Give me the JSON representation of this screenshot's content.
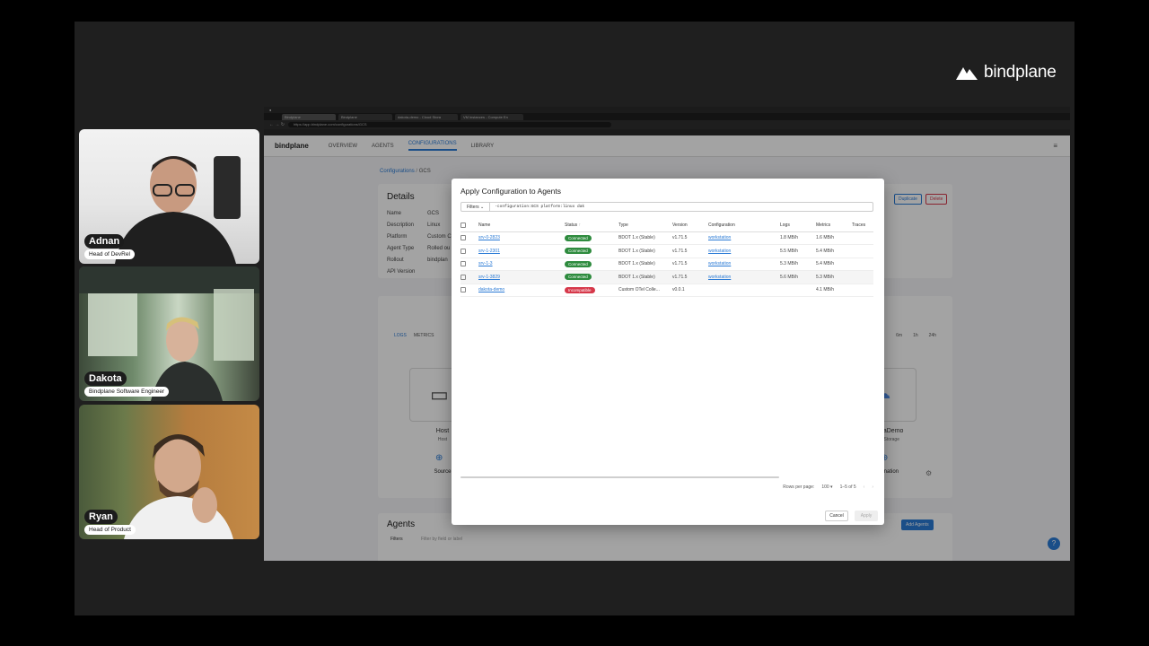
{
  "brand": {
    "name": "bindplane"
  },
  "participants": [
    {
      "name": "Adnan",
      "role": "Head of DevRel"
    },
    {
      "name": "Dakota",
      "role": "Bindplane Software Engineer"
    },
    {
      "name": "Ryan",
      "role": "Head of Product"
    }
  ],
  "browser": {
    "tabs": [
      "Bindplane",
      "Bindplane",
      "dakota-demo - Cloud Stora",
      "VM instances - Compute En"
    ],
    "url": "https://app.bindplane.com/configurations/GCS"
  },
  "app": {
    "logo": "bindplane",
    "nav": [
      "OVERVIEW",
      "AGENTS",
      "CONFIGURATIONS",
      "LIBRARY"
    ],
    "breadcrumb": [
      "Configurations",
      "GCS"
    ],
    "details": {
      "title": "Details",
      "labels": [
        "Name",
        "Description",
        "Platform",
        "Agent Type",
        "Rollout",
        "API Version"
      ],
      "values": [
        "GCS",
        "",
        "Linux",
        "Custom C",
        "Rolled ou",
        "bindplan"
      ]
    },
    "buttons": {
      "duplicate": "Duplicate",
      "delete": "Delete",
      "add_agents": "Add Agents"
    },
    "telemetry_tabs": [
      "LOGS",
      "METRICS"
    ],
    "ranges": [
      "6m",
      "1h",
      "24h"
    ],
    "source": {
      "name": "Host",
      "type": "Host",
      "label": "Source"
    },
    "destination": {
      "name": "DakotaDemo",
      "type": "Cloud Storage",
      "label": "Destination"
    },
    "agents_section": {
      "title": "Agents",
      "filters": "Filters",
      "placeholder": "Filter by field or label"
    }
  },
  "modal": {
    "title": "Apply Configuration to Agents",
    "filters_label": "Filters",
    "query": "-configuration:GCS platform:linux dak",
    "columns": [
      "Name",
      "Status",
      "Type",
      "Version",
      "Configuration",
      "Logs",
      "Metrics",
      "Traces"
    ],
    "rows": [
      {
        "name": "srv-0-2823",
        "status": "Connected",
        "type": "BDOT 1.x (Stable)",
        "version": "v1.71.5",
        "configuration": "workstation",
        "logs": "1.8 MB/h",
        "metrics": "1.6 MB/h"
      },
      {
        "name": "srv-1-2301",
        "status": "Connected",
        "type": "BDOT 1.x (Stable)",
        "version": "v1.71.5",
        "configuration": "workstation",
        "logs": "5.5 MB/h",
        "metrics": "5.4 MB/h"
      },
      {
        "name": "srv-1-3",
        "status": "Connected",
        "type": "BDOT 1.x (Stable)",
        "version": "v1.71.5",
        "configuration": "workstation",
        "logs": "5.3 MB/h",
        "metrics": "5.4 MB/h"
      },
      {
        "name": "srv-1-3829",
        "status": "Connected",
        "type": "BDOT 1.x (Stable)",
        "version": "v1.71.5",
        "configuration": "workstation",
        "logs": "5.6 MB/h",
        "metrics": "5.3 MB/h"
      },
      {
        "name": "dakota-demo",
        "status": "Incompatible",
        "type": "Custom OTel Colle...",
        "version": "v0.0.1",
        "configuration": "",
        "logs": "",
        "metrics": "4.1 MB/h"
      }
    ],
    "rows_per_page_label": "Rows per page:",
    "rows_per_page": "100",
    "range": "1–5 of 5",
    "cancel": "Cancel",
    "apply": "Apply"
  },
  "colors": {
    "connected": "#2e8b3e",
    "incompatible": "#d6384a",
    "link": "#2a7ad5"
  }
}
